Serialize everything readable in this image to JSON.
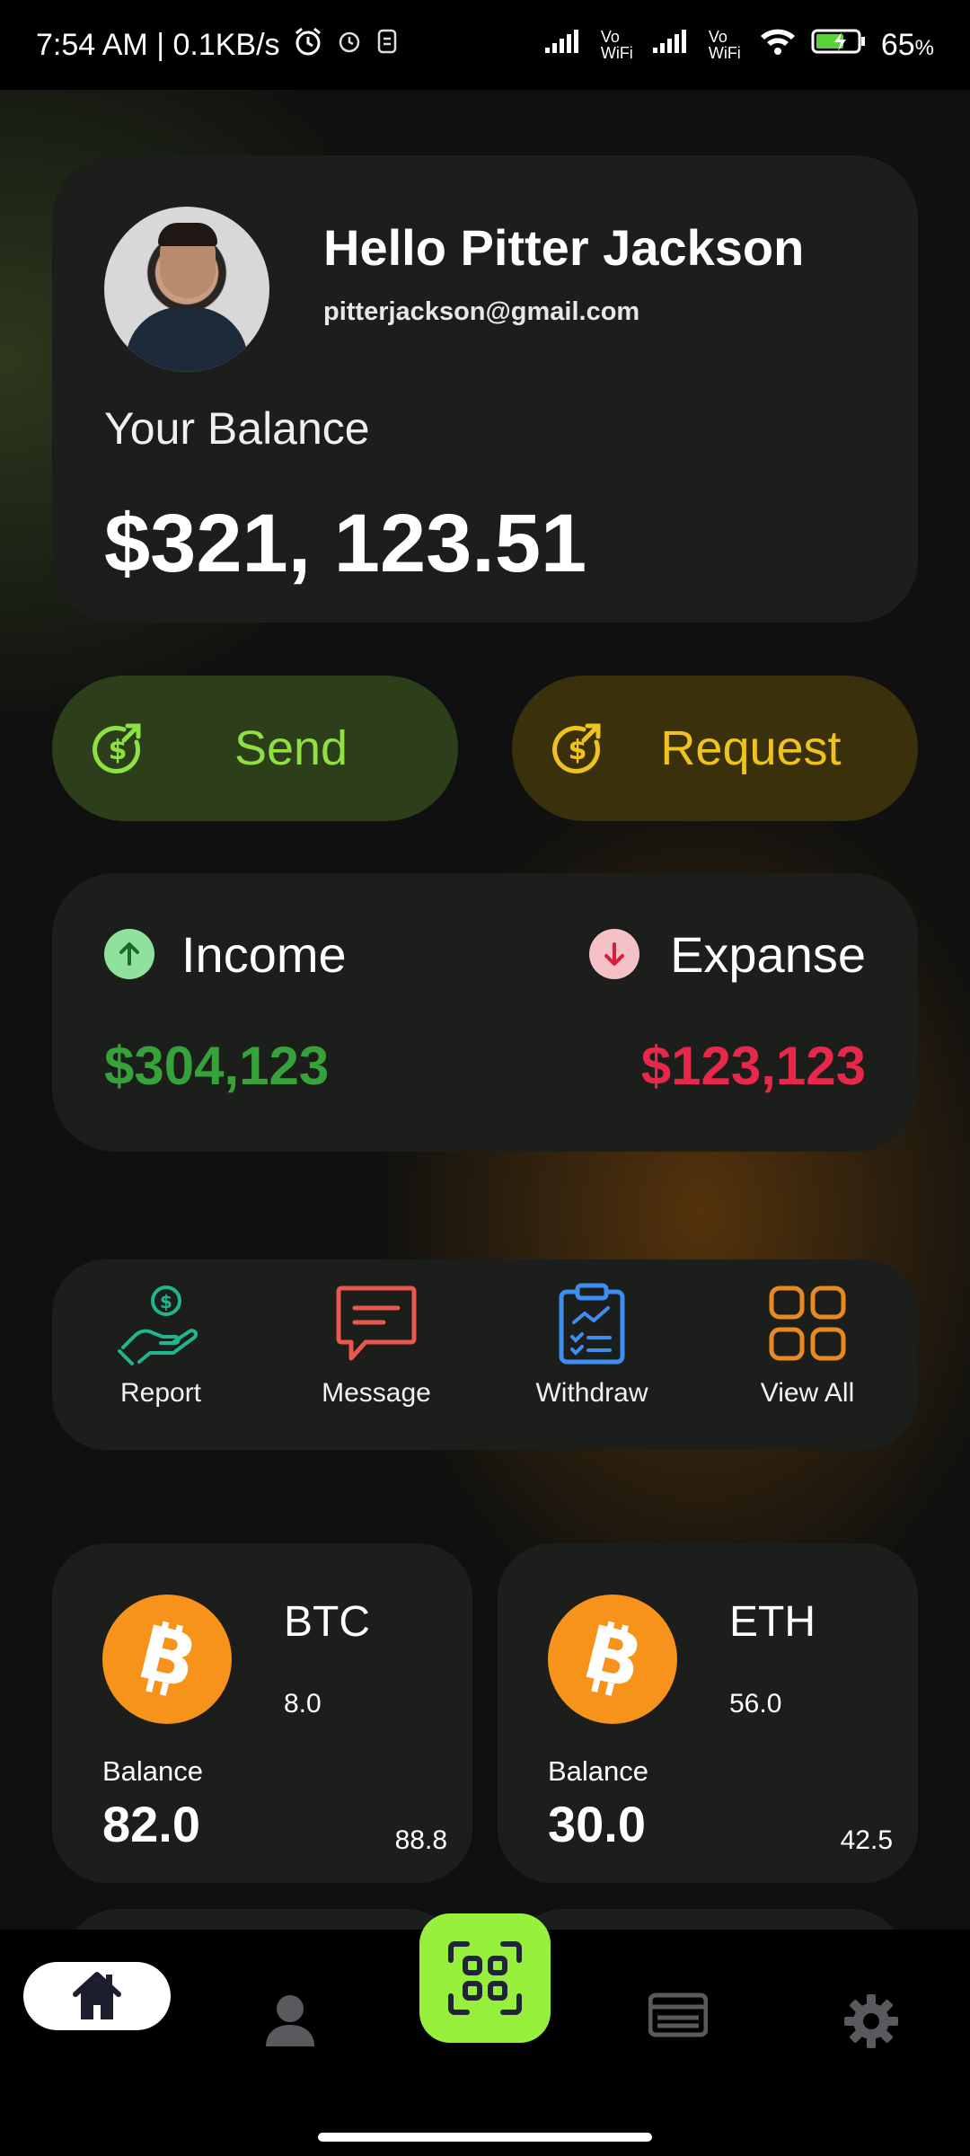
{
  "status_bar": {
    "time_speed": "7:54 AM | 0.1KB/s",
    "battery": "65",
    "battery_unit": "%",
    "network_labels": [
      "Vo WiFi",
      "Vo WiFi"
    ],
    "icons": [
      "alarm-icon",
      "alarm-clock-icon",
      "sim-icon",
      "signal-icon",
      "wifi-icon",
      "battery-charging-icon"
    ]
  },
  "profile": {
    "greeting": "Hello Pitter Jackson",
    "email": "pitterjackson@gmail.com",
    "balance_label": "Your Balance",
    "balance_value": "$321, 123.51"
  },
  "actions": {
    "send_label": "Send",
    "request_label": "Request"
  },
  "summary": {
    "income_label": "Income",
    "income_value": "$304,123",
    "expense_label": "Expanse",
    "expense_value": "$123,123"
  },
  "quick_actions": [
    {
      "label": "Report",
      "icon": "hand-coin-icon"
    },
    {
      "label": "Message",
      "icon": "message-icon"
    },
    {
      "label": "Withdraw",
      "icon": "clipboard-chart-icon"
    },
    {
      "label": "View All",
      "icon": "grid-icon"
    }
  ],
  "coins": [
    {
      "symbol": "BTC",
      "amount": "8.0",
      "balance_label": "Balance",
      "balance": "82.0",
      "side_value": "88.8",
      "icon": "bitcoin-icon"
    },
    {
      "symbol": "ETH",
      "amount": "56.0",
      "balance_label": "Balance",
      "balance": "30.0",
      "side_value": "42.5",
      "icon": "bitcoin-icon"
    }
  ],
  "bottom_nav": [
    "home-icon",
    "profile-icon",
    "qr-scan-icon",
    "card-icon",
    "settings-icon"
  ],
  "colors": {
    "background": "#0f100f",
    "card": "#1c1e1b",
    "send": "#8ee043",
    "request": "#f0c21d",
    "income": "#36a33a",
    "expense": "#e8284a",
    "scan": "#96f03c",
    "bitcoin": "#f7931a"
  }
}
